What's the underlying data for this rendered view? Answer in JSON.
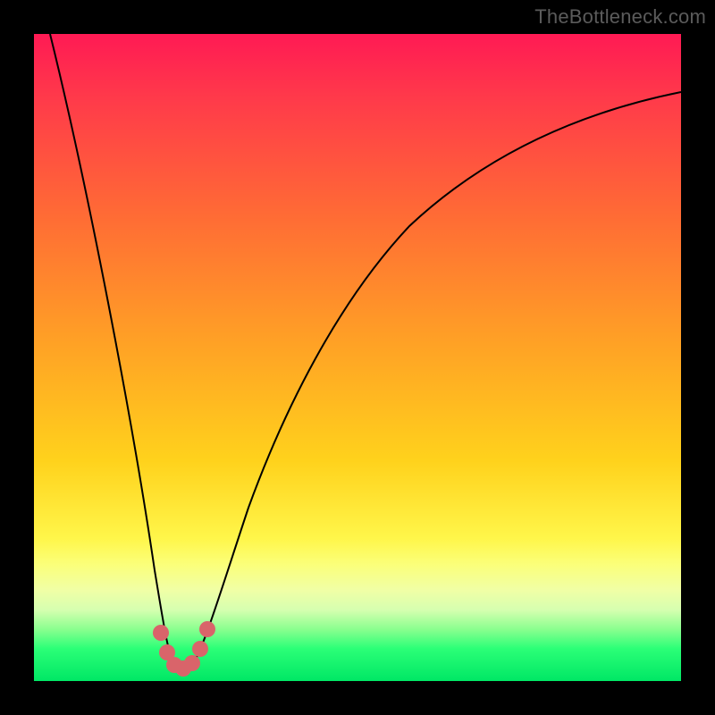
{
  "watermark": {
    "text": "TheBottleneck.com"
  },
  "chart_data": {
    "type": "line",
    "title": "",
    "xlabel": "",
    "ylabel": "",
    "xlim": [
      0,
      100
    ],
    "ylim": [
      0,
      100
    ],
    "grid": false,
    "legend": false,
    "series": [
      {
        "name": "curve",
        "color": "#000000",
        "x": [
          0,
          3,
          6,
          9,
          12,
          14,
          16,
          17,
          18,
          19,
          20,
          21,
          22,
          23,
          24,
          26,
          28,
          30,
          33,
          36,
          40,
          45,
          50,
          56,
          62,
          70,
          78,
          86,
          94,
          100
        ],
        "values": [
          100,
          87,
          74,
          61,
          48,
          38,
          28,
          22,
          15,
          9,
          4,
          1,
          0,
          1,
          4,
          11,
          20,
          28,
          38,
          46,
          54,
          61,
          67,
          72,
          76,
          80,
          83,
          85,
          87,
          88
        ]
      },
      {
        "name": "highlight-dots",
        "color": "#d9646a",
        "x": [
          18.5,
          19.5,
          20.5,
          21.5,
          22.5,
          23.5,
          24.5
        ],
        "values": [
          9,
          4,
          1,
          0,
          1,
          4,
          9
        ]
      }
    ],
    "background_gradient": {
      "stops": [
        {
          "pos": 0,
          "color": "#ff1a54"
        },
        {
          "pos": 28,
          "color": "#ff6b35"
        },
        {
          "pos": 66,
          "color": "#ffd21c"
        },
        {
          "pos": 86,
          "color": "#f0ffa6"
        },
        {
          "pos": 100,
          "color": "#00e765"
        }
      ]
    }
  }
}
